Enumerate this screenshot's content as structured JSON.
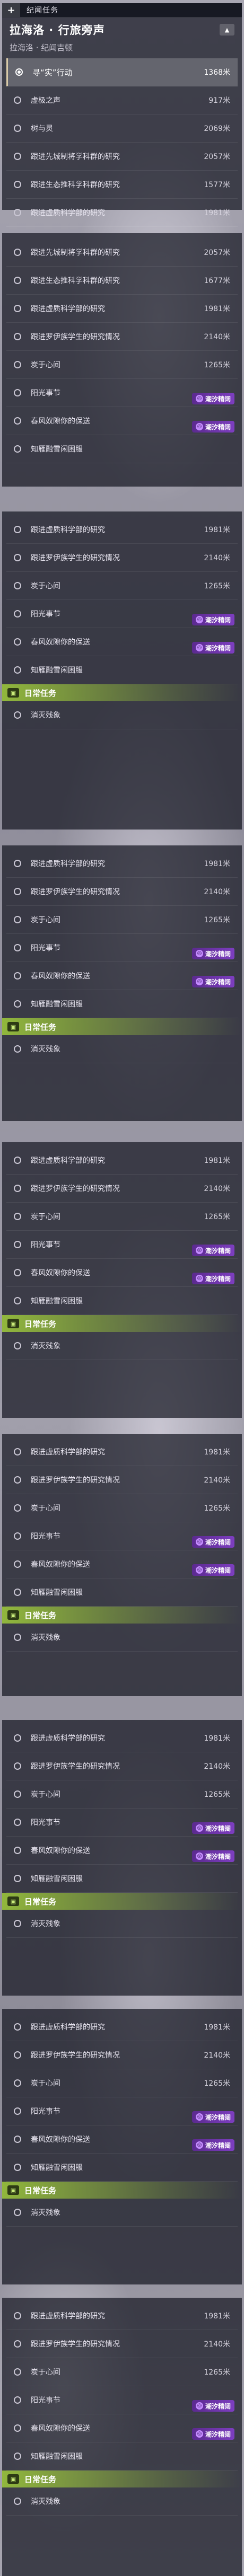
{
  "header": {
    "tab_label": "纪闻任务",
    "quest_title": "拉海洛 · 行旅旁声",
    "quest_sub": "拉海洛 · 纪闻吉顿",
    "collapse_icon": "chevron-up-icon"
  },
  "first_list": [
    {
      "name": "寻“实”行动",
      "dist": "1368米",
      "active": true
    },
    {
      "name": "虚极之声",
      "dist": "917米"
    },
    {
      "name": "树与灵",
      "dist": "2069米"
    },
    {
      "name": "跟进先城制将学科群的研究",
      "dist": "2057米"
    },
    {
      "name": "跟进生态推科学科群的研究",
      "dist": "1577米"
    },
    {
      "name": "跟进虚质科学部的研究",
      "dist": "1981米"
    }
  ],
  "labels": {
    "c1": "跟进先城制将学科群的研究",
    "c2": "跟进生态推科学科群的研究",
    "c3": "跟进虚质科学部的研究",
    "c4": "跟进罗伊族学生的研究情况",
    "c5": "炭于心间",
    "c6": "阳光事节",
    "c7": "春风奴隙你的保送",
    "c8": "知雁融雪闲困服",
    "daily": "日常任务",
    "c9": "消灭残象"
  },
  "dists": {
    "c1": "2057米",
    "c2": "1677米",
    "c3": "1981米",
    "c4": "2140米",
    "c5": "1265米"
  },
  "badge_label": "潮汐精阔",
  "badge_icon": "swirl-icon",
  "daily_icon": "daily-quest-icon"
}
